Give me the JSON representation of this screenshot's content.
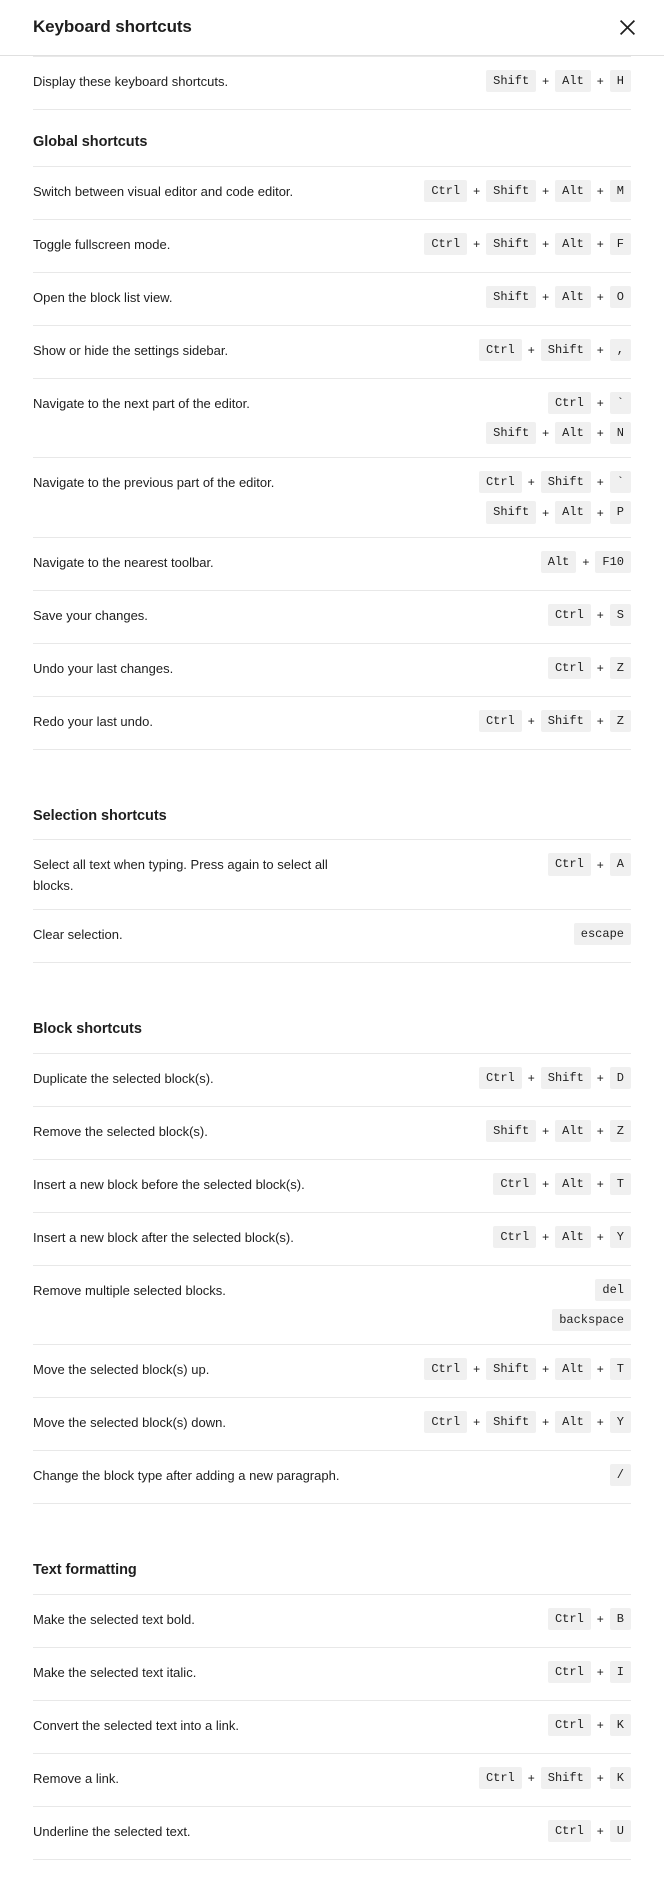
{
  "modal": {
    "title": "Keyboard shortcuts",
    "close_icon": "close-icon",
    "close_label": "Close"
  },
  "intro": {
    "rows": [
      {
        "description": "Display these keyboard shortcuts.",
        "combos": [
          [
            "Shift",
            "Alt",
            "H"
          ]
        ]
      }
    ]
  },
  "sections": [
    {
      "title": "Global shortcuts",
      "rows": [
        {
          "description": "Switch between visual editor and code editor.",
          "combos": [
            [
              "Ctrl",
              "Shift",
              "Alt",
              "M"
            ]
          ]
        },
        {
          "description": "Toggle fullscreen mode.",
          "combos": [
            [
              "Ctrl",
              "Shift",
              "Alt",
              "F"
            ]
          ]
        },
        {
          "description": "Open the block list view.",
          "combos": [
            [
              "Shift",
              "Alt",
              "O"
            ]
          ]
        },
        {
          "description": "Show or hide the settings sidebar.",
          "combos": [
            [
              "Ctrl",
              "Shift",
              ","
            ]
          ]
        },
        {
          "description": "Navigate to the next part of the editor.",
          "combos": [
            [
              "Ctrl",
              "`"
            ],
            [
              "Shift",
              "Alt",
              "N"
            ]
          ]
        },
        {
          "description": "Navigate to the previous part of the editor.",
          "combos": [
            [
              "Ctrl",
              "Shift",
              "`"
            ],
            [
              "Shift",
              "Alt",
              "P"
            ]
          ]
        },
        {
          "description": "Navigate to the nearest toolbar.",
          "combos": [
            [
              "Alt",
              "F10"
            ]
          ]
        },
        {
          "description": "Save your changes.",
          "combos": [
            [
              "Ctrl",
              "S"
            ]
          ]
        },
        {
          "description": "Undo your last changes.",
          "combos": [
            [
              "Ctrl",
              "Z"
            ]
          ]
        },
        {
          "description": "Redo your last undo.",
          "combos": [
            [
              "Ctrl",
              "Shift",
              "Z"
            ]
          ]
        }
      ]
    },
    {
      "title": "Selection shortcuts",
      "rows": [
        {
          "description": "Select all text when typing. Press again to select all blocks.",
          "combos": [
            [
              "Ctrl",
              "A"
            ]
          ]
        },
        {
          "description": "Clear selection.",
          "combos": [
            [
              "escape"
            ]
          ]
        }
      ]
    },
    {
      "title": "Block shortcuts",
      "rows": [
        {
          "description": "Duplicate the selected block(s).",
          "combos": [
            [
              "Ctrl",
              "Shift",
              "D"
            ]
          ]
        },
        {
          "description": "Remove the selected block(s).",
          "combos": [
            [
              "Shift",
              "Alt",
              "Z"
            ]
          ]
        },
        {
          "description": "Insert a new block before the selected block(s).",
          "combos": [
            [
              "Ctrl",
              "Alt",
              "T"
            ]
          ]
        },
        {
          "description": "Insert a new block after the selected block(s).",
          "combos": [
            [
              "Ctrl",
              "Alt",
              "Y"
            ]
          ]
        },
        {
          "description": "Remove multiple selected blocks.",
          "combos": [
            [
              "del"
            ],
            [
              "backspace"
            ]
          ]
        },
        {
          "description": "Move the selected block(s) up.",
          "combos": [
            [
              "Ctrl",
              "Shift",
              "Alt",
              "T"
            ]
          ]
        },
        {
          "description": "Move the selected block(s) down.",
          "combos": [
            [
              "Ctrl",
              "Shift",
              "Alt",
              "Y"
            ]
          ]
        },
        {
          "description": "Change the block type after adding a new paragraph.",
          "combos": [
            [
              "/"
            ]
          ]
        }
      ]
    },
    {
      "title": "Text formatting",
      "rows": [
        {
          "description": "Make the selected text bold.",
          "combos": [
            [
              "Ctrl",
              "B"
            ]
          ]
        },
        {
          "description": "Make the selected text italic.",
          "combos": [
            [
              "Ctrl",
              "I"
            ]
          ]
        },
        {
          "description": "Convert the selected text into a link.",
          "combos": [
            [
              "Ctrl",
              "K"
            ]
          ]
        },
        {
          "description": "Remove a link.",
          "combos": [
            [
              "Ctrl",
              "Shift",
              "K"
            ]
          ]
        },
        {
          "description": "Underline the selected text.",
          "combos": [
            [
              "Ctrl",
              "U"
            ]
          ]
        }
      ]
    }
  ],
  "separator": "+",
  "colors": {
    "background": "#ffffff",
    "text": "#1e1e1e",
    "kbd_background": "#f0f0f0",
    "divider": "#e8e8e8",
    "header_divider": "#e0e0e0"
  }
}
